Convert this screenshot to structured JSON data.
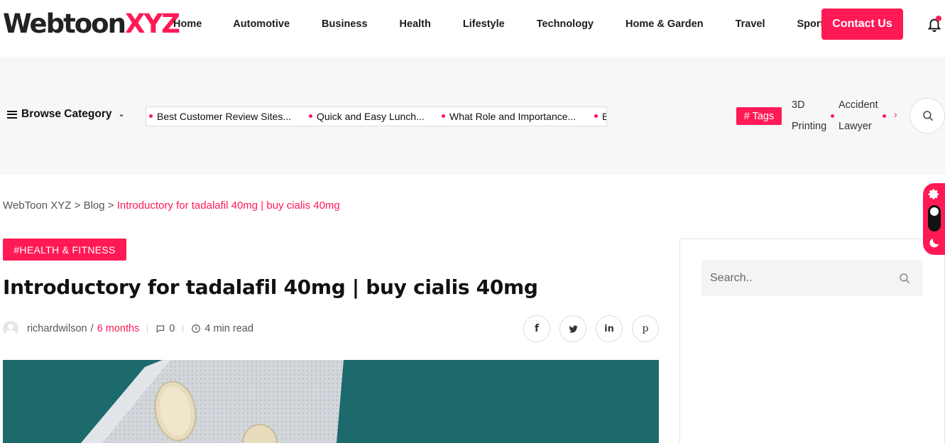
{
  "brand": {
    "part1": "Webtoon",
    "part2": "XYZ"
  },
  "nav": {
    "items": [
      "Home",
      "Automotive",
      "Business",
      "Health",
      "Lifestyle",
      "Technology",
      "Home & Garden",
      "Travel",
      "Sports"
    ],
    "contact_label": "Contact Us"
  },
  "category_bar": {
    "browse_label": "Browse Category",
    "ticker": [
      "Best Customer Review Sites...",
      "Quick and Easy Lunch...",
      "What Role and Importance...",
      "B"
    ],
    "tags_label": "# Tags",
    "tags": [
      "3D Printing",
      "Accident Lawyer"
    ],
    "tag_lines": [
      [
        "3D",
        "Printing"
      ],
      [
        "Accident",
        "Lawyer"
      ]
    ],
    "next_arrow": "›"
  },
  "breadcrumb": {
    "home": "WebToon XYZ",
    "sep": " > ",
    "blog": "Blog",
    "current": "Introductory for tadalafil 40mg | buy cialis 40mg"
  },
  "article": {
    "category": "#HEALTH & FITNESS",
    "title": "Introductory for tadalafil 40mg | buy cialis 40mg",
    "author": "richardwilson",
    "author_sep": "/",
    "time_ago": "6 months",
    "comments": "0",
    "read_time": "4 min read",
    "socials": [
      "facebook",
      "twitter",
      "linkedin",
      "pinterest"
    ]
  },
  "sidebar": {
    "search_placeholder": "Search.."
  },
  "colors": {
    "accent": "#ff1a55",
    "hero_bg": "#1d6a6d",
    "catbar_bg": "#f7f7f7"
  }
}
